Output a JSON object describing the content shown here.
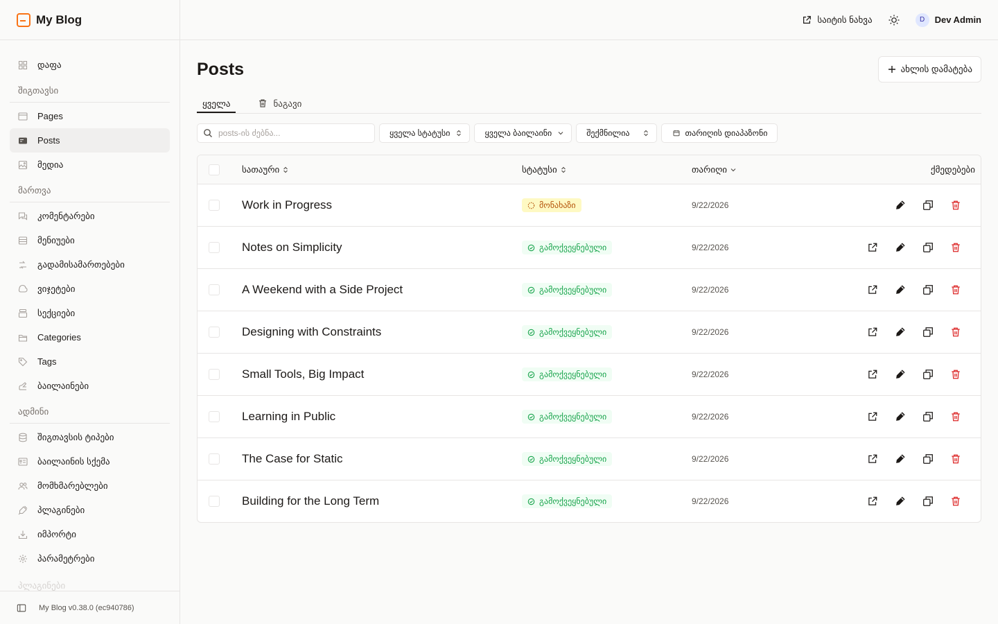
{
  "brand": {
    "name": "My Blog"
  },
  "sidebar": {
    "top": [
      {
        "label": "დაფა",
        "icon": "dashboard-icon"
      }
    ],
    "sections": [
      {
        "title": "შიგთავსი",
        "items": [
          {
            "label": "Pages",
            "icon": "page-icon"
          },
          {
            "label": "Posts",
            "icon": "post-icon",
            "active": true
          },
          {
            "label": "მედია",
            "icon": "media-icon"
          }
        ]
      },
      {
        "title": "მართვა",
        "items": [
          {
            "label": "კომენტარები",
            "icon": "comments-icon"
          },
          {
            "label": "მენიუები",
            "icon": "menu-icon"
          },
          {
            "label": "გადამისამართებები",
            "icon": "redirect-icon"
          },
          {
            "label": "ვიჯეტები",
            "icon": "widget-icon"
          },
          {
            "label": "სექციები",
            "icon": "section-icon"
          },
          {
            "label": "Categories",
            "icon": "folder-icon"
          },
          {
            "label": "Tags",
            "icon": "tag-icon"
          },
          {
            "label": "ბაილაინები",
            "icon": "byline-icon"
          }
        ]
      },
      {
        "title": "ადმინი",
        "items": [
          {
            "label": "შიგთავსის ტიპები",
            "icon": "database-icon"
          },
          {
            "label": "ბაილაინის სქემა",
            "icon": "schema-icon"
          },
          {
            "label": "მომხმარებლები",
            "icon": "users-icon"
          },
          {
            "label": "პლაგინები",
            "icon": "plugin-icon"
          },
          {
            "label": "იმპორტი",
            "icon": "import-icon"
          },
          {
            "label": "პარამეტრები",
            "icon": "settings-icon"
          }
        ]
      }
    ],
    "next_section": "პლაგინები",
    "footer": "My Blog v0.38.0 (ec940786)"
  },
  "header": {
    "view_site": "საიტის ნახვა",
    "user_initial": "D",
    "user_name": "Dev Admin"
  },
  "main": {
    "title": "Posts",
    "add_new": "ახლის დამატება",
    "tabs": [
      {
        "label": "ყველა",
        "active": true
      },
      {
        "label": "ნაგავი",
        "active": false
      }
    ],
    "filters": {
      "search_placeholder": "posts-ის ძებნა...",
      "status": "ყველა სტატუსი",
      "bylines": "ყველა ბაილაინი",
      "sort": "შექმნილია",
      "date_range": "თარიღის დიაპაზონი"
    },
    "table": {
      "headers": {
        "title": "სათაური",
        "status": "სტატუსი",
        "date": "თარიღი",
        "actions": "ქმედებები"
      },
      "rows": [
        {
          "title": "Work in Progress",
          "status": "მონახაზი",
          "status_type": "draft",
          "date": "9/22/2026"
        },
        {
          "title": "Notes on Simplicity",
          "status": "გამოქვეყნებული",
          "status_type": "published",
          "date": "9/22/2026"
        },
        {
          "title": "A Weekend with a Side Project",
          "status": "გამოქვეყნებული",
          "status_type": "published",
          "date": "9/22/2026"
        },
        {
          "title": "Designing with Constraints",
          "status": "გამოქვეყნებული",
          "status_type": "published",
          "date": "9/22/2026"
        },
        {
          "title": "Small Tools, Big Impact",
          "status": "გამოქვეყნებული",
          "status_type": "published",
          "date": "9/22/2026"
        },
        {
          "title": "Learning in Public",
          "status": "გამოქვეყნებული",
          "status_type": "published",
          "date": "9/22/2026"
        },
        {
          "title": "The Case for Static",
          "status": "გამოქვეყნებული",
          "status_type": "published",
          "date": "9/22/2026"
        },
        {
          "title": "Building for the Long Term",
          "status": "გამოქვეყნებული",
          "status_type": "published",
          "date": "9/22/2026"
        }
      ]
    }
  },
  "colors": {
    "accent": "#f97316",
    "published": "#16a34a",
    "draft": "#b45309",
    "danger": "#dc2626"
  }
}
